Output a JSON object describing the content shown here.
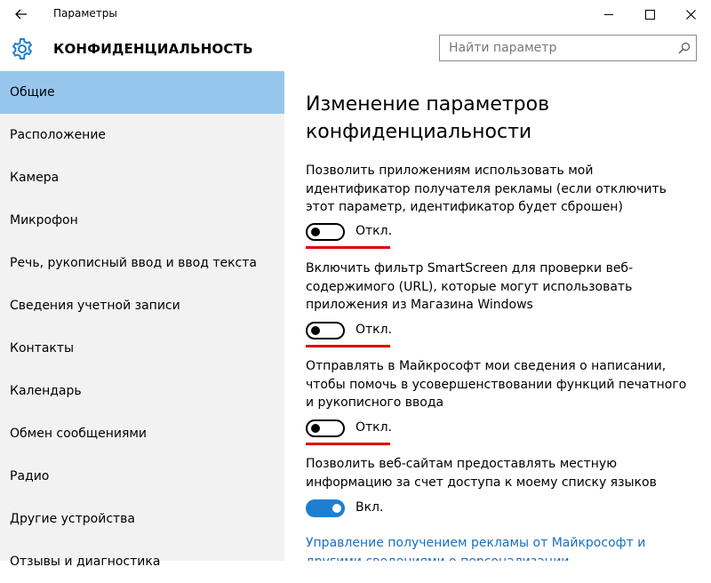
{
  "window": {
    "title": "Параметры",
    "back_icon": "arrow-left-icon",
    "minimize_icon": "minimize-icon",
    "maximize_icon": "maximize-icon",
    "close_icon": "close-icon"
  },
  "header": {
    "icon": "gear-icon",
    "title": "КОНФИДЕНЦИАЛЬНОСТЬ",
    "search_placeholder": "Найти параметр",
    "search_icon": "search-icon"
  },
  "sidebar": {
    "items": [
      {
        "label": "Общие",
        "active": true
      },
      {
        "label": "Расположение",
        "active": false
      },
      {
        "label": "Камера",
        "active": false
      },
      {
        "label": "Микрофон",
        "active": false
      },
      {
        "label": "Речь, рукописный ввод и ввод текста",
        "active": false
      },
      {
        "label": "Сведения учетной записи",
        "active": false
      },
      {
        "label": "Контакты",
        "active": false
      },
      {
        "label": "Календарь",
        "active": false
      },
      {
        "label": "Обмен сообщениями",
        "active": false
      },
      {
        "label": "Радио",
        "active": false
      },
      {
        "label": "Другие устройства",
        "active": false
      },
      {
        "label": "Отзывы и диагностика",
        "active": false
      }
    ]
  },
  "main": {
    "title": "Изменение параметров конфиденциальности",
    "settings": [
      {
        "description": "Позволить приложениям использовать мой идентификатор получателя рекламы (если отключить этот параметр, идентификатор будет сброшен)",
        "state": "Откл.",
        "on": false
      },
      {
        "description": "Включить фильтр SmartScreen для проверки веб-содержимого (URL), которые могут использовать приложения из Магазина Windows",
        "state": "Откл.",
        "on": false
      },
      {
        "description": "Отправлять в Майкрософт мои сведения о написании, чтобы помочь в усовершенствовании функций печатного и рукописного ввода",
        "state": "Откл.",
        "on": false
      },
      {
        "description": "Позволить веб-сайтам предоставлять местную информацию за счет доступа к моему списку языков",
        "state": "Вкл.",
        "on": true
      }
    ],
    "link": "Управление получением рекламы от Майкрософт и другими сведениями о персонализации"
  },
  "colors": {
    "accent": "#1e7fd0",
    "sidebar_bg": "#f2f2f2",
    "active_item_bg": "#97c6ed",
    "annotation_red": "#e00000",
    "link": "#1a6fc0"
  }
}
